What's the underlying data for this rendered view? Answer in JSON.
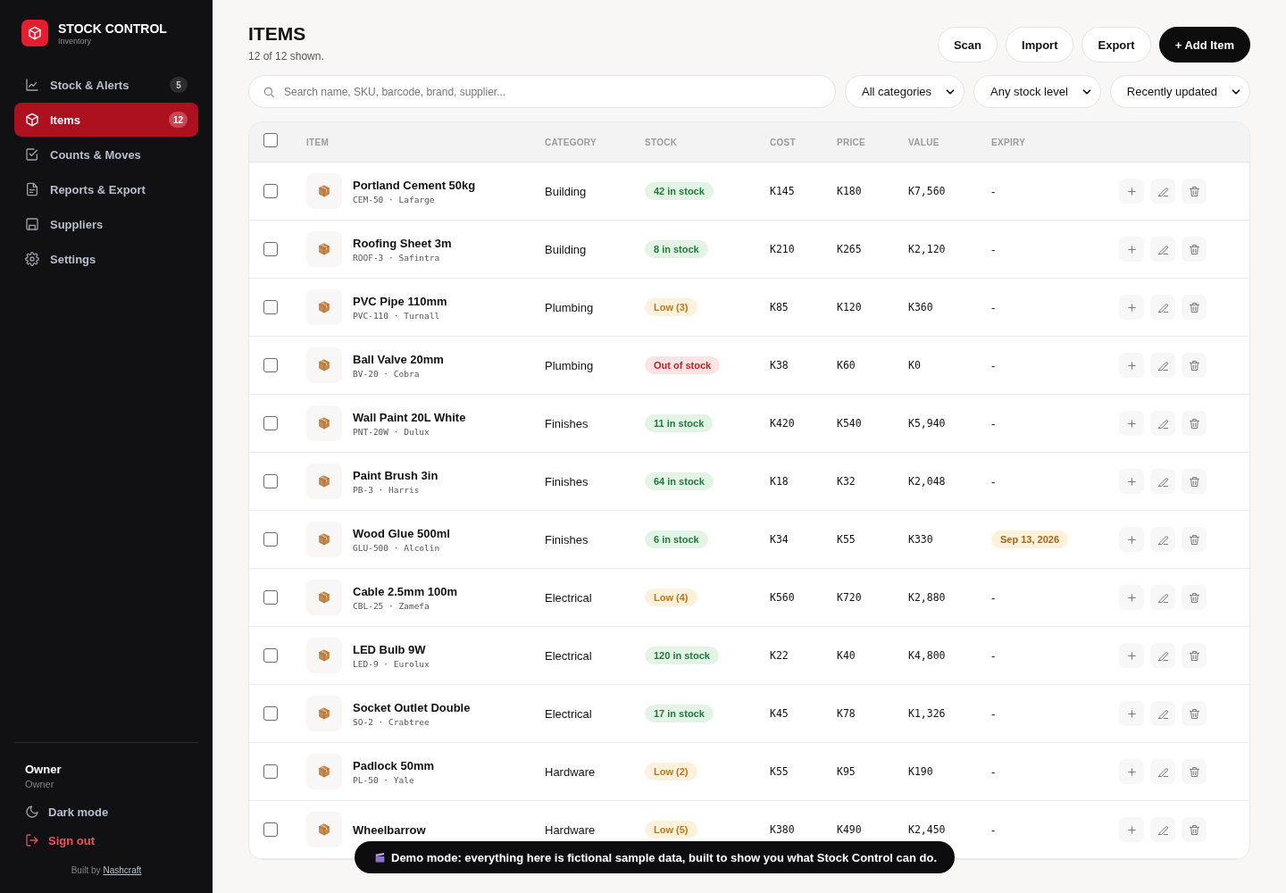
{
  "sidebar": {
    "brand": {
      "title": "STOCK CONTROL",
      "subtitle": "Inventory"
    },
    "items": [
      {
        "label": "Stock & Alerts",
        "badge": "5",
        "selected": false
      },
      {
        "label": "Items",
        "badge": "12",
        "selected": true
      },
      {
        "label": "Counts & Moves",
        "selected": false
      },
      {
        "label": "Reports & Export",
        "selected": false
      },
      {
        "label": "Suppliers",
        "selected": false
      },
      {
        "label": "Settings",
        "selected": false
      }
    ],
    "user": {
      "name": "Owner",
      "role": "Owner"
    },
    "dark_mode": "Dark mode",
    "sign_out": "Sign out",
    "credit": {
      "text": "Built by",
      "link": "Nashcraft"
    }
  },
  "header": {
    "title": "ITEMS",
    "subtitle": "12 of 12 shown.",
    "buttons": [
      {
        "label": "Scan",
        "kind": "outline"
      },
      {
        "label": "Import",
        "kind": "outline"
      },
      {
        "label": "Export",
        "kind": "outline"
      },
      {
        "label": "+ Add Item",
        "kind": "primary"
      }
    ]
  },
  "filters": {
    "search": {
      "placeholder": "Search name, SKU, barcode, brand, supplier..."
    },
    "dropdowns": [
      "All categories",
      "Any stock level",
      "Recently updated"
    ]
  },
  "table": {
    "select_all": {
      "checked": false
    },
    "columns": [
      "ITEM",
      "CATEGORY",
      "STOCK",
      "COST",
      "PRICE",
      "VALUE",
      "EXPIRY"
    ],
    "rows": [
      {
        "checked": false,
        "name": "Portland Cement 50kg",
        "sku": "CEM-50 · Lafarge",
        "category": "Building",
        "stock": {
          "text": "42 in stock",
          "kind": "ok"
        },
        "cost": "K145",
        "price": "K180",
        "value": "K7,560",
        "expiry": {
          "text": "-",
          "soon": false
        }
      },
      {
        "checked": false,
        "name": "Roofing Sheet 3m",
        "sku": "ROOF-3 · Safintra",
        "category": "Building",
        "stock": {
          "text": "8 in stock",
          "kind": "ok"
        },
        "cost": "K210",
        "price": "K265",
        "value": "K2,120",
        "expiry": {
          "text": "-",
          "soon": false
        }
      },
      {
        "checked": false,
        "name": "PVC Pipe 110mm",
        "sku": "PVC-110 · Turnall",
        "category": "Plumbing",
        "stock": {
          "text": "Low (3)",
          "kind": "low"
        },
        "cost": "K85",
        "price": "K120",
        "value": "K360",
        "expiry": {
          "text": "-",
          "soon": false
        }
      },
      {
        "checked": false,
        "name": "Ball Valve 20mm",
        "sku": "BV-20 · Cobra",
        "category": "Plumbing",
        "stock": {
          "text": "Out of stock",
          "kind": "out"
        },
        "cost": "K38",
        "price": "K60",
        "value": "K0",
        "expiry": {
          "text": "-",
          "soon": false
        }
      },
      {
        "checked": false,
        "name": "Wall Paint 20L White",
        "sku": "PNT-20W · Dulux",
        "category": "Finishes",
        "stock": {
          "text": "11 in stock",
          "kind": "ok"
        },
        "cost": "K420",
        "price": "K540",
        "value": "K5,940",
        "expiry": {
          "text": "-",
          "soon": false
        }
      },
      {
        "checked": false,
        "name": "Paint Brush 3in",
        "sku": "PB-3 · Harris",
        "category": "Finishes",
        "stock": {
          "text": "64 in stock",
          "kind": "ok"
        },
        "cost": "K18",
        "price": "K32",
        "value": "K2,048",
        "expiry": {
          "text": "-",
          "soon": false
        }
      },
      {
        "checked": false,
        "name": "Wood Glue 500ml",
        "sku": "GLU-500 · Alcolin",
        "category": "Finishes",
        "stock": {
          "text": "6 in stock",
          "kind": "ok"
        },
        "cost": "K34",
        "price": "K55",
        "value": "K330",
        "expiry": {
          "text": "Sep 13, 2026",
          "soon": true
        }
      },
      {
        "checked": false,
        "name": "Cable 2.5mm 100m",
        "sku": "CBL-25 · Zamefa",
        "category": "Electrical",
        "stock": {
          "text": "Low (4)",
          "kind": "low"
        },
        "cost": "K560",
        "price": "K720",
        "value": "K2,880",
        "expiry": {
          "text": "-",
          "soon": false
        }
      },
      {
        "checked": false,
        "name": "LED Bulb 9W",
        "sku": "LED-9 · Eurolux",
        "category": "Electrical",
        "stock": {
          "text": "120 in stock",
          "kind": "ok"
        },
        "cost": "K22",
        "price": "K40",
        "value": "K4,800",
        "expiry": {
          "text": "-",
          "soon": false
        }
      },
      {
        "checked": false,
        "name": "Socket Outlet Double",
        "sku": "SO-2 · Crabtree",
        "category": "Electrical",
        "stock": {
          "text": "17 in stock",
          "kind": "ok"
        },
        "cost": "K45",
        "price": "K78",
        "value": "K1,326",
        "expiry": {
          "text": "-",
          "soon": false
        }
      },
      {
        "checked": false,
        "name": "Padlock 50mm",
        "sku": "PL-50 · Yale",
        "category": "Hardware",
        "stock": {
          "text": "Low (2)",
          "kind": "low"
        },
        "cost": "K55",
        "price": "K95",
        "value": "K190",
        "expiry": {
          "text": "-",
          "soon": false
        }
      },
      {
        "checked": false,
        "name": "Wheelbarrow",
        "category": "Hardware",
        "stock": {
          "text": "Low (5)",
          "kind": "low"
        },
        "cost": "K380",
        "price": "K490",
        "value": "K2,450",
        "expiry": {
          "text": "-",
          "soon": false
        }
      }
    ]
  },
  "toast": {
    "text": "Demo mode: everything here is fictional sample data, built to show you what Stock Control can do."
  }
}
